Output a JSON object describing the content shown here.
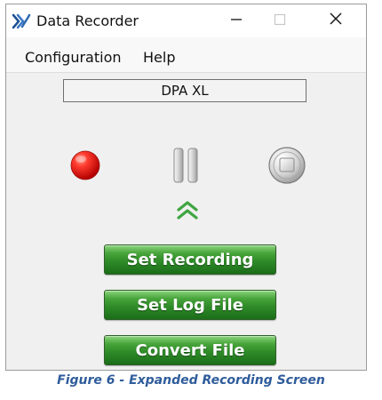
{
  "window": {
    "title": "Data Recorder",
    "icon": "data-recorder-app-icon",
    "controls": [
      "minimize-icon",
      "maximize-icon",
      "close-icon"
    ]
  },
  "menu": {
    "items": [
      {
        "label": "Configuration"
      },
      {
        "label": "Help"
      }
    ]
  },
  "device": {
    "name": "DPA XL"
  },
  "transport": {
    "record_icon": "record-icon",
    "pause_icon": "pause-icon",
    "stop_icon": "stop-icon",
    "expand_icon": "double-chevron-up-icon"
  },
  "actions": {
    "set_recording": "Set Recording",
    "set_log_file": "Set Log File",
    "convert_file": "Convert File"
  },
  "caption": {
    "text": "Figure 6 - Expanded Recording Screen"
  },
  "colors": {
    "window_bg": "#f0f0f0",
    "button_green": "#2f8c28",
    "record_red": "#e11a1a",
    "expand_green": "#3fa541",
    "caption_blue": "#2f5c9b"
  }
}
